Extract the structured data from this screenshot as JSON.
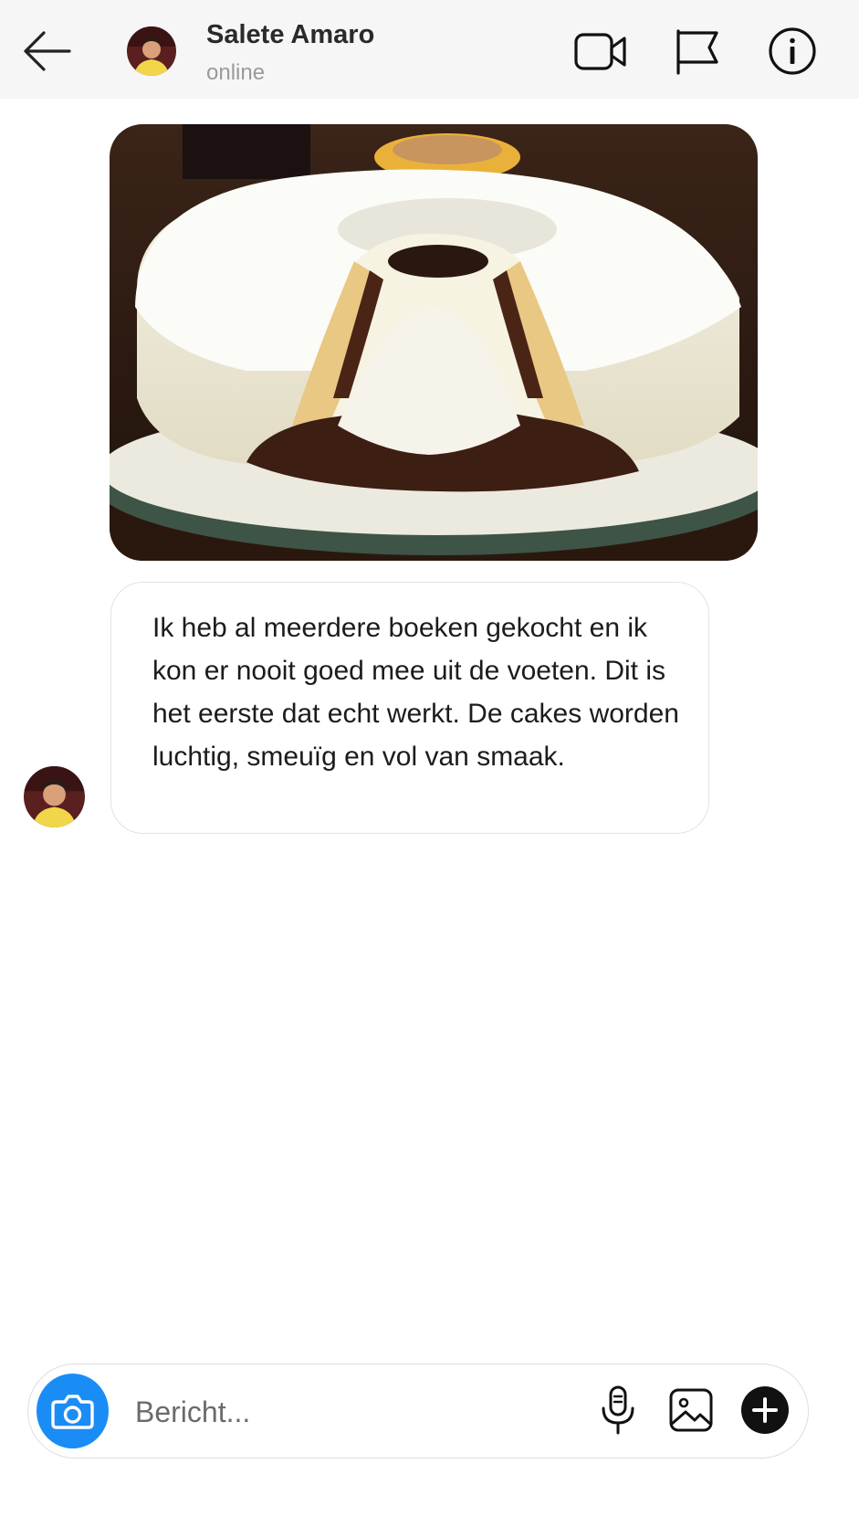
{
  "header": {
    "contact_name": "Salete Amaro",
    "status": "online"
  },
  "icons": {
    "back": "arrow-left-icon",
    "video": "video-camera-icon",
    "flag": "flag-icon",
    "info": "info-icon",
    "camera": "camera-icon",
    "mic": "microphone-icon",
    "gallery": "image-icon",
    "plus": "plus-icon"
  },
  "messages": [
    {
      "type": "image",
      "content": "cake-photo"
    },
    {
      "type": "text",
      "text": "Ik heb al meerdere boeken gekocht en ik kon er nooit goed mee uit de voeten. Dit is het eerste dat echt werkt. De cakes worden luchtig, smeuïg en vol van smaak."
    }
  ],
  "composer": {
    "placeholder": "Bericht..."
  },
  "colors": {
    "header_bg": "#f6f6f6",
    "camera_button": "#1a8cf5",
    "plus_button": "#111111"
  }
}
